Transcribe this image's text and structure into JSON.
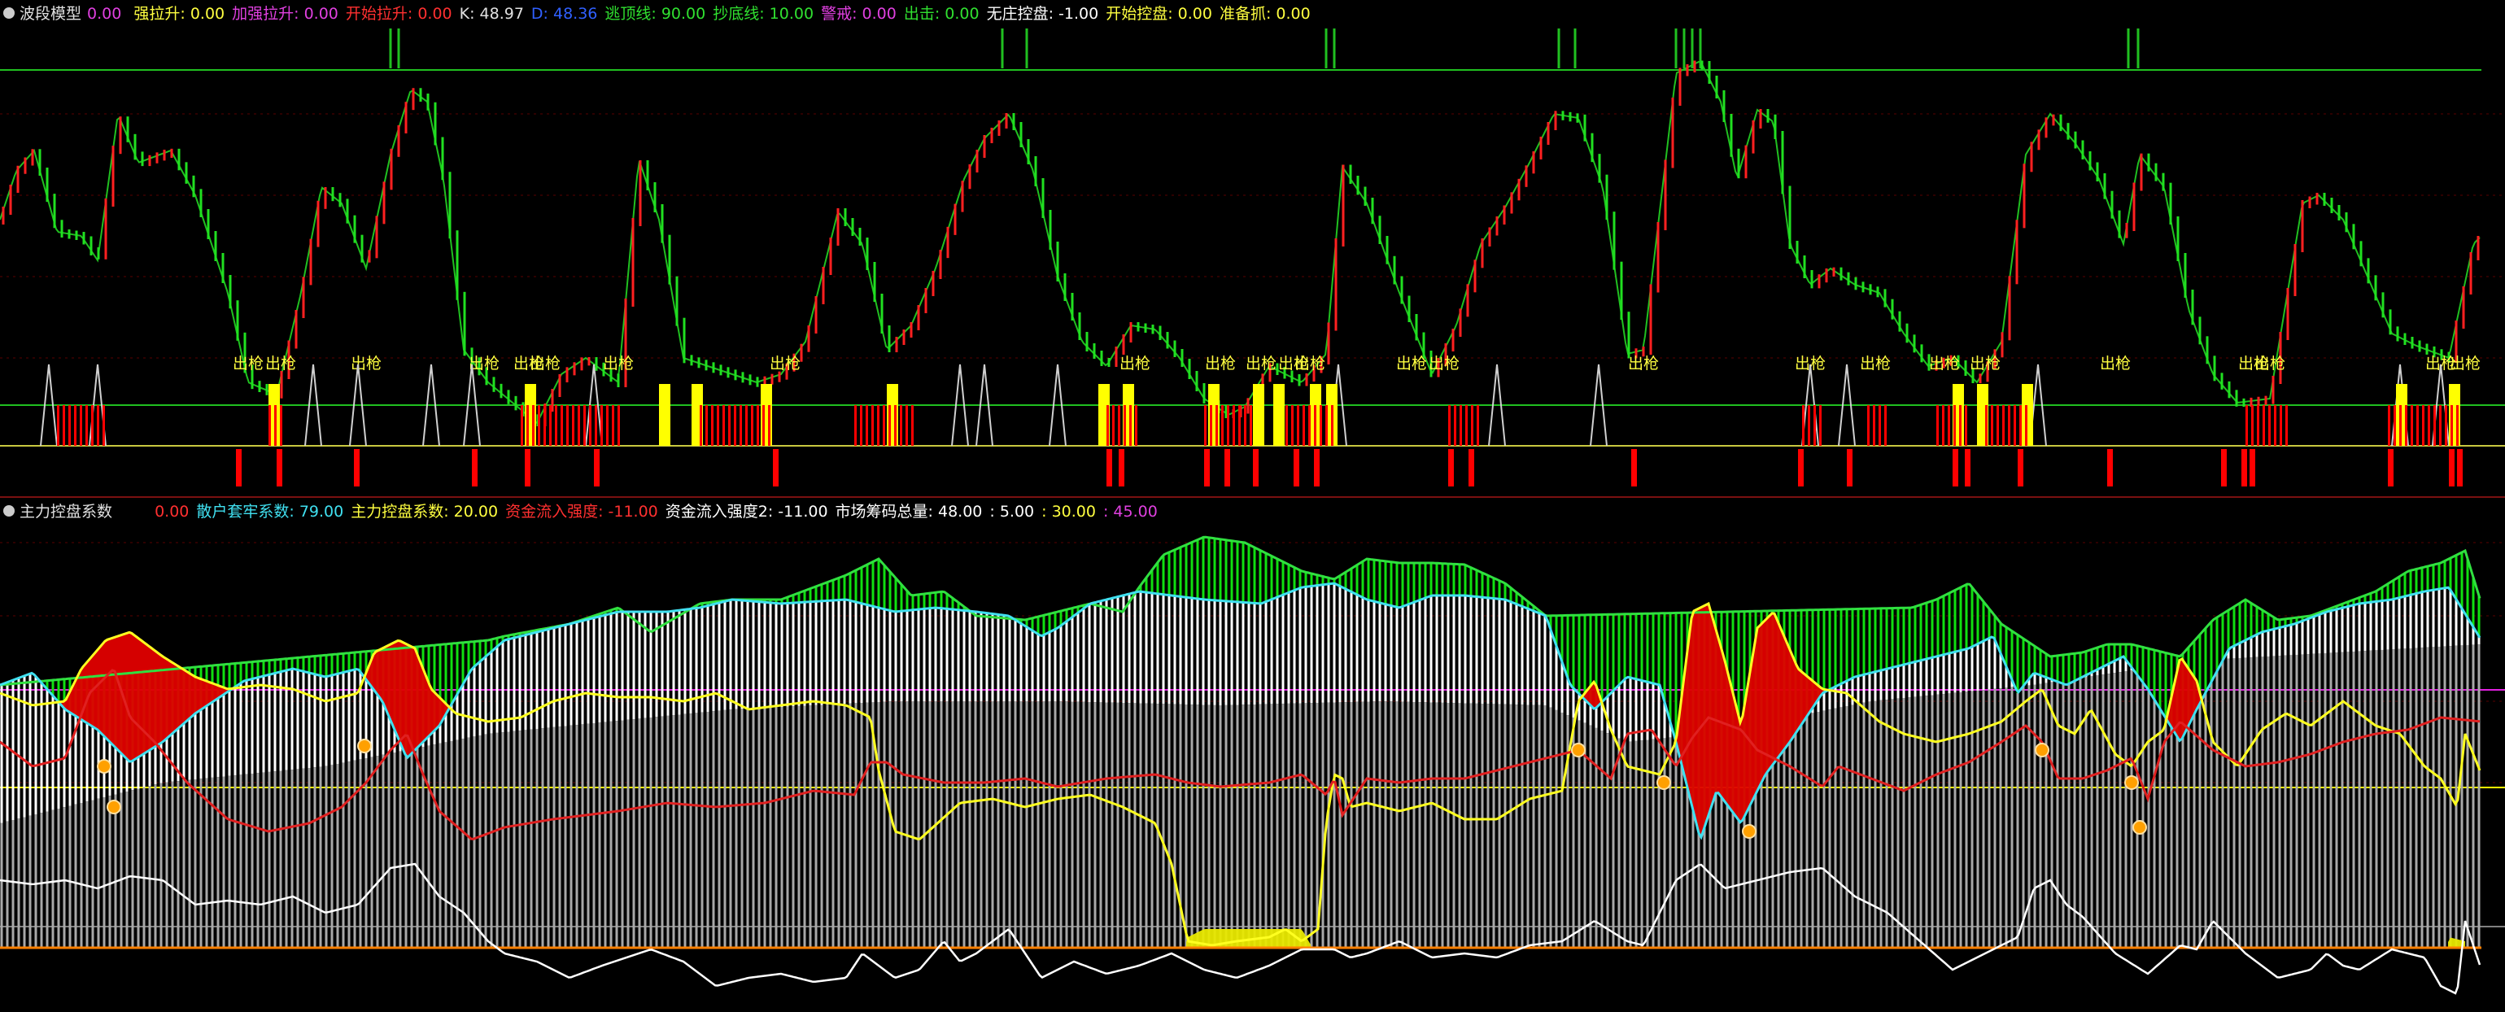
{
  "colors": {
    "bg": "#000000",
    "up": "#ff2020",
    "down": "#20e020",
    "white": "#ffffff",
    "yellow": "#ffff00",
    "cyan": "#40e0f0",
    "magenta": "#e020e0",
    "green": "#00ff00",
    "red": "#ff0000",
    "grey": "#c0c0c0",
    "orange": "#ff8000"
  },
  "panel1": {
    "title": "波段模型",
    "indicators": [
      {
        "label": "强拉升:",
        "value": "0.00",
        "color": "#ffff40"
      },
      {
        "label": "加强拉升:",
        "value": "0.00",
        "color": "#e040e0"
      },
      {
        "label": "开始拉升:",
        "value": "0.00",
        "color": "#ff3030"
      },
      {
        "label": "K:",
        "value": "48.97",
        "color": "#e0e0e0"
      },
      {
        "label": "D:",
        "value": "48.36",
        "color": "#3060ff"
      },
      {
        "label": "逃顶线:",
        "value": "90.00",
        "color": "#30e030"
      },
      {
        "label": "抄底线:",
        "value": "10.00",
        "color": "#30e030"
      },
      {
        "label": "警戒:",
        "value": "0.00",
        "color": "#e040e0"
      },
      {
        "label": "出击:",
        "value": "0.00",
        "color": "#30e030"
      },
      {
        "label": "无庄控盘:",
        "value": "-1.00",
        "color": "#ffffff"
      },
      {
        "label": "开始控盘:",
        "value": "0.00",
        "color": "#ffff40"
      },
      {
        "label": "准备抓:",
        "value": "0.00",
        "color": "#ffff40"
      }
    ],
    "signal_label": "出枪",
    "title_value": "0.00"
  },
  "panel2": {
    "title": "主力控盘系数",
    "indicators": [
      {
        "label": "",
        "value": "0.00",
        "color": "#ff3030"
      },
      {
        "label": "散户套牢系数:",
        "value": "79.00",
        "color": "#40e0f0"
      },
      {
        "label": "主力控盘系数:",
        "value": "20.00",
        "color": "#ffff40"
      },
      {
        "label": "资金流入强度:",
        "value": "-11.00",
        "color": "#ff3030"
      },
      {
        "label": "资金流入强度2:",
        "value": "-11.00",
        "color": "#ffffff"
      },
      {
        "label": "市场筹码总量:",
        "value": "48.00",
        "color": "#ffffff"
      },
      {
        "label": ":",
        "value": "5.00",
        "color": "#ffffff"
      },
      {
        "label": ":",
        "value": "30.00",
        "color": "#ffff40"
      },
      {
        "label": ":",
        "value": "45.00",
        "color": "#e040e0"
      }
    ]
  }
}
